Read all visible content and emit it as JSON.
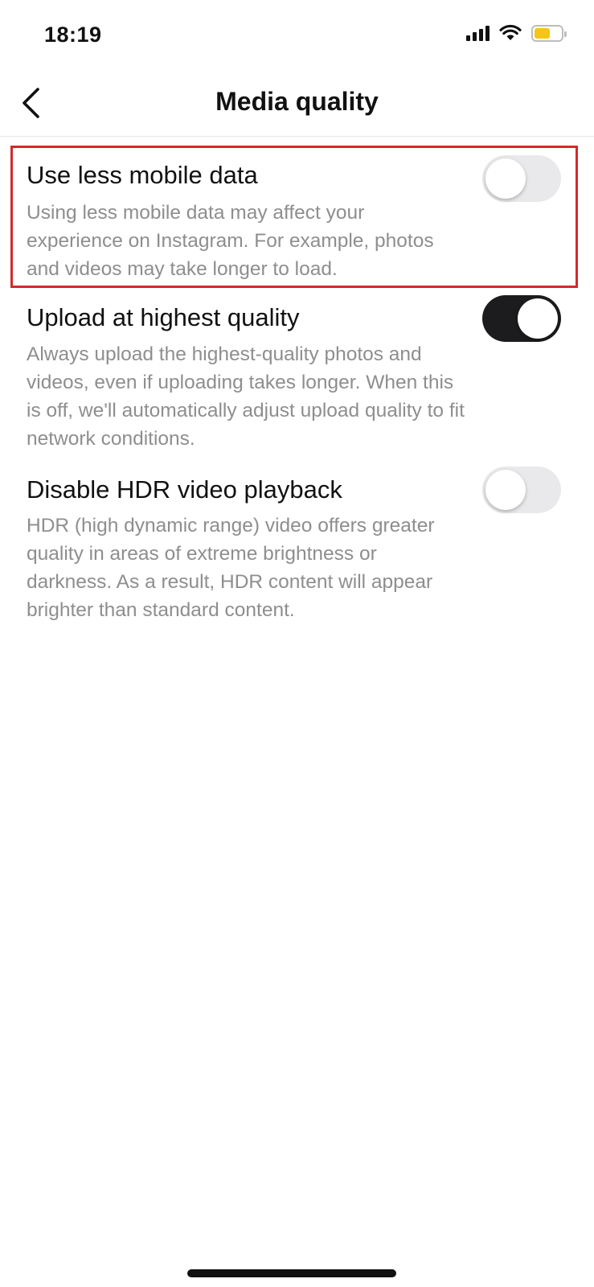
{
  "status_bar": {
    "time": "18:19",
    "battery_color": "#f5c518"
  },
  "header": {
    "title": "Media quality",
    "back_icon": "chevron-left-icon"
  },
  "settings": [
    {
      "title": "Use less mobile data",
      "description": "Using less mobile data may affect your experience on Instagram. For example, photos and videos may take longer to load.",
      "enabled": false
    },
    {
      "title": "Upload at highest quality",
      "description": "Always upload the highest-quality photos and videos, even if uploading takes longer. When this is off, we'll automatically adjust upload quality to fit network conditions.",
      "enabled": true
    },
    {
      "title": "Disable HDR video playback",
      "description": "HDR (high dynamic range) video offers greater quality in areas of extreme brightness or darkness. As a result, HDR content will appear brighter than standard content.",
      "enabled": false
    }
  ],
  "colors": {
    "highlight": "#d42a2a",
    "toggle_on": "#1c1c1e",
    "toggle_off": "#e9e9eb"
  }
}
